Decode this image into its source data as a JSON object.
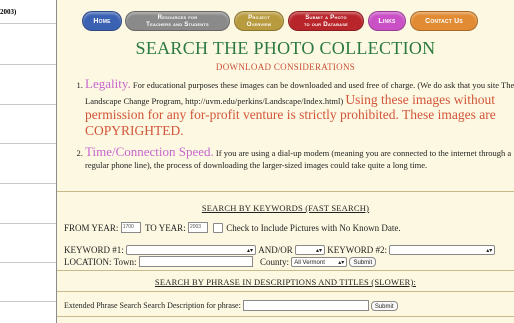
{
  "left": {
    "fragment": "2003)"
  },
  "nav": {
    "home": "Home",
    "resources_1": "Resources for",
    "resources_2": "Teachers and Students",
    "project_1": "Project",
    "project_2": "Overview",
    "submit_1": "Submit a Photo",
    "submit_2": "to our Database",
    "links": "Links",
    "contact": "Contact Us"
  },
  "heading": {
    "title": "SEARCH THE PHOTO COLLECTION",
    "subtitle": "DOWNLOAD CONSIDERATIONS"
  },
  "considerations": [
    {
      "lead": "Legality.",
      "text": " For educational purposes these images can be downloaded and used free of charge. (We do ask that you site The Landscape Change Program, http://uvm.edu/perkins/Landscape/Index.html) ",
      "warning": "Using these images without permission for any for-profit venture is strictly prohibited. These images are COPYRIGHTED."
    },
    {
      "lead": "Time/Connection Speed.",
      "text": " If you are using a dial-up modem (meaning you are connected to the internet through a regular phone line), the process of downloading the larger-sized images could take quite a long time."
    }
  ],
  "keyword_search": {
    "heading": "SEARCH BY KEYWORDS (FAST SEARCH)",
    "from_year_label": "FROM YEAR:",
    "from_year_value": "1700",
    "to_year_label": "TO YEAR:",
    "to_year_value": "2003",
    "no_date_label": "Check to Include Pictures with No Known Date.",
    "keyword1_label": "KEYWORD #1:",
    "andor_label": "AND/OR",
    "keyword2_label": "KEYWORD #2:",
    "location_label": "LOCATION: Town:",
    "county_label": "County:",
    "county_value": "All Vermont",
    "submit": "Submit"
  },
  "phrase_search": {
    "heading": "SEARCH BY PHRASE IN DESCRIPTIONS AND TITLES (SLOWER):",
    "phrase_label": "Extended Phrase Search Search Description for phrase:",
    "submit": "Submit"
  }
}
